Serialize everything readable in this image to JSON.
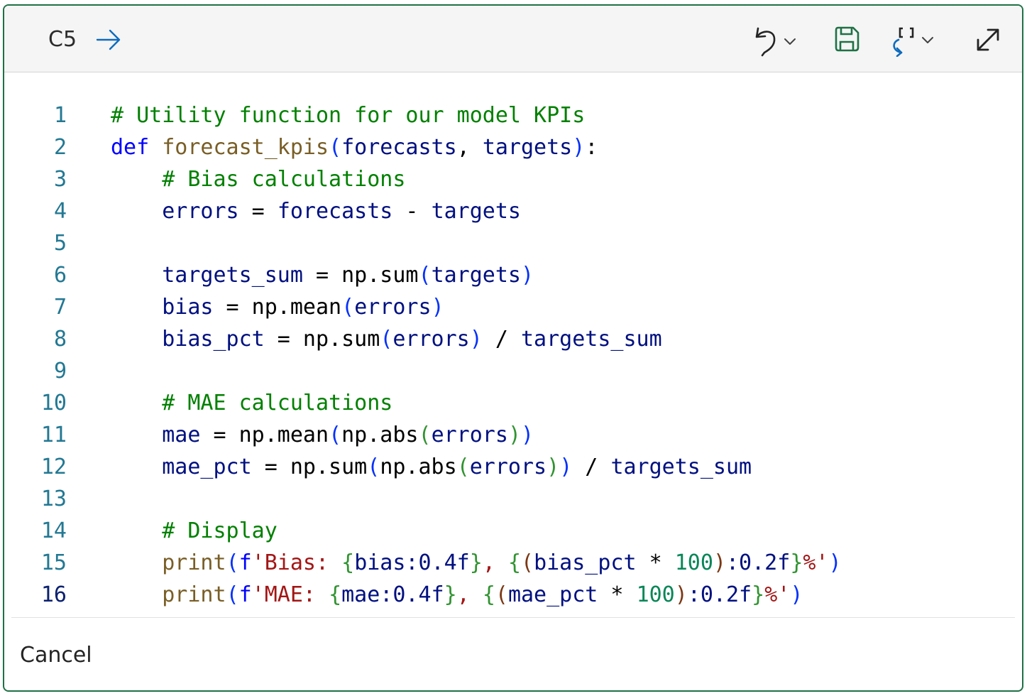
{
  "header": {
    "cell_ref": "C5",
    "arrow_icon": "arrow-right-icon",
    "undo_icon": "undo-icon",
    "save_icon": "save-icon",
    "reset_icon": "reset-brackets-icon",
    "expand_icon": "expand-icon"
  },
  "colors": {
    "border": "#1e7145",
    "comment": "#008000",
    "keyword": "#0000ff",
    "function": "#795e26",
    "variable": "#001080",
    "string": "#a31515",
    "number": "#098658",
    "plain": "#000000",
    "line_number": "#237893"
  },
  "code": {
    "lines": [
      {
        "num": "1",
        "tokens": [
          {
            "t": "# Utility function for our model KPIs",
            "c": "#008000"
          }
        ]
      },
      {
        "num": "2",
        "tokens": [
          {
            "t": "def",
            "c": "#0000ff"
          },
          {
            "t": " ",
            "c": "#000000"
          },
          {
            "t": "forecast_kpis",
            "c": "#795e26"
          },
          {
            "t": "(",
            "c": "#0431fa"
          },
          {
            "t": "forecasts",
            "c": "#001080"
          },
          {
            "t": ", ",
            "c": "#000000"
          },
          {
            "t": "targets",
            "c": "#001080"
          },
          {
            "t": ")",
            "c": "#0431fa"
          },
          {
            "t": ":",
            "c": "#000000"
          }
        ]
      },
      {
        "num": "3",
        "tokens": [
          {
            "t": "    # Bias calculations",
            "c": "#008000"
          }
        ]
      },
      {
        "num": "4",
        "tokens": [
          {
            "t": "    errors",
            "c": "#001080"
          },
          {
            "t": " = ",
            "c": "#000000"
          },
          {
            "t": "forecasts",
            "c": "#001080"
          },
          {
            "t": " - ",
            "c": "#000000"
          },
          {
            "t": "targets",
            "c": "#001080"
          }
        ]
      },
      {
        "num": "5",
        "tokens": []
      },
      {
        "num": "6",
        "tokens": [
          {
            "t": "    targets_sum",
            "c": "#001080"
          },
          {
            "t": " = np.sum",
            "c": "#000000"
          },
          {
            "t": "(",
            "c": "#0431fa"
          },
          {
            "t": "targets",
            "c": "#001080"
          },
          {
            "t": ")",
            "c": "#0431fa"
          }
        ]
      },
      {
        "num": "7",
        "tokens": [
          {
            "t": "    bias",
            "c": "#001080"
          },
          {
            "t": " = np.mean",
            "c": "#000000"
          },
          {
            "t": "(",
            "c": "#0431fa"
          },
          {
            "t": "errors",
            "c": "#001080"
          },
          {
            "t": ")",
            "c": "#0431fa"
          }
        ]
      },
      {
        "num": "8",
        "tokens": [
          {
            "t": "    bias_pct",
            "c": "#001080"
          },
          {
            "t": " = np.sum",
            "c": "#000000"
          },
          {
            "t": "(",
            "c": "#0431fa"
          },
          {
            "t": "errors",
            "c": "#001080"
          },
          {
            "t": ")",
            "c": "#0431fa"
          },
          {
            "t": " / ",
            "c": "#000000"
          },
          {
            "t": "targets_sum",
            "c": "#001080"
          }
        ]
      },
      {
        "num": "9",
        "tokens": []
      },
      {
        "num": "10",
        "tokens": [
          {
            "t": "    # MAE calculations",
            "c": "#008000"
          }
        ]
      },
      {
        "num": "11",
        "tokens": [
          {
            "t": "    mae",
            "c": "#001080"
          },
          {
            "t": " = np.mean",
            "c": "#000000"
          },
          {
            "t": "(",
            "c": "#0431fa"
          },
          {
            "t": "np.abs",
            "c": "#000000"
          },
          {
            "t": "(",
            "c": "#319331"
          },
          {
            "t": "errors",
            "c": "#001080"
          },
          {
            "t": ")",
            "c": "#319331"
          },
          {
            "t": ")",
            "c": "#0431fa"
          }
        ]
      },
      {
        "num": "12",
        "tokens": [
          {
            "t": "    mae_pct",
            "c": "#001080"
          },
          {
            "t": " = np.sum",
            "c": "#000000"
          },
          {
            "t": "(",
            "c": "#0431fa"
          },
          {
            "t": "np.abs",
            "c": "#000000"
          },
          {
            "t": "(",
            "c": "#319331"
          },
          {
            "t": "errors",
            "c": "#001080"
          },
          {
            "t": ")",
            "c": "#319331"
          },
          {
            "t": ")",
            "c": "#0431fa"
          },
          {
            "t": " / ",
            "c": "#000000"
          },
          {
            "t": "targets_sum",
            "c": "#001080"
          }
        ]
      },
      {
        "num": "13",
        "tokens": []
      },
      {
        "num": "14",
        "tokens": [
          {
            "t": "    # Display",
            "c": "#008000"
          }
        ]
      },
      {
        "num": "15",
        "tokens": [
          {
            "t": "    print",
            "c": "#795e26"
          },
          {
            "t": "(",
            "c": "#0431fa"
          },
          {
            "t": "f",
            "c": "#0000ff"
          },
          {
            "t": "'Bias: ",
            "c": "#a31515"
          },
          {
            "t": "{",
            "c": "#319331"
          },
          {
            "t": "bias:0.4f",
            "c": "#001080"
          },
          {
            "t": "}",
            "c": "#319331"
          },
          {
            "t": ", ",
            "c": "#a31515"
          },
          {
            "t": "{",
            "c": "#319331"
          },
          {
            "t": "(",
            "c": "#7b3814"
          },
          {
            "t": "bias_pct",
            "c": "#001080"
          },
          {
            "t": " * ",
            "c": "#000000"
          },
          {
            "t": "100",
            "c": "#098658"
          },
          {
            "t": ")",
            "c": "#7b3814"
          },
          {
            "t": ":0.2f",
            "c": "#001080"
          },
          {
            "t": "}",
            "c": "#319331"
          },
          {
            "t": "%'",
            "c": "#a31515"
          },
          {
            "t": ")",
            "c": "#0431fa"
          }
        ]
      },
      {
        "num": "16",
        "tokens": [
          {
            "t": "    print",
            "c": "#795e26"
          },
          {
            "t": "(",
            "c": "#0431fa"
          },
          {
            "t": "f",
            "c": "#0000ff"
          },
          {
            "t": "'MAE: ",
            "c": "#a31515"
          },
          {
            "t": "{",
            "c": "#319331"
          },
          {
            "t": "mae:0.4f",
            "c": "#001080"
          },
          {
            "t": "}",
            "c": "#319331"
          },
          {
            "t": ", ",
            "c": "#a31515"
          },
          {
            "t": "{",
            "c": "#319331"
          },
          {
            "t": "(",
            "c": "#7b3814"
          },
          {
            "t": "mae_pct",
            "c": "#001080"
          },
          {
            "t": " * ",
            "c": "#000000"
          },
          {
            "t": "100",
            "c": "#098658"
          },
          {
            "t": ")",
            "c": "#7b3814"
          },
          {
            "t": ":0.2f",
            "c": "#001080"
          },
          {
            "t": "}",
            "c": "#319331"
          },
          {
            "t": "%'",
            "c": "#a31515"
          },
          {
            "t": ")",
            "c": "#0431fa"
          }
        ]
      }
    ]
  },
  "footer": {
    "cancel_label": "Cancel"
  }
}
